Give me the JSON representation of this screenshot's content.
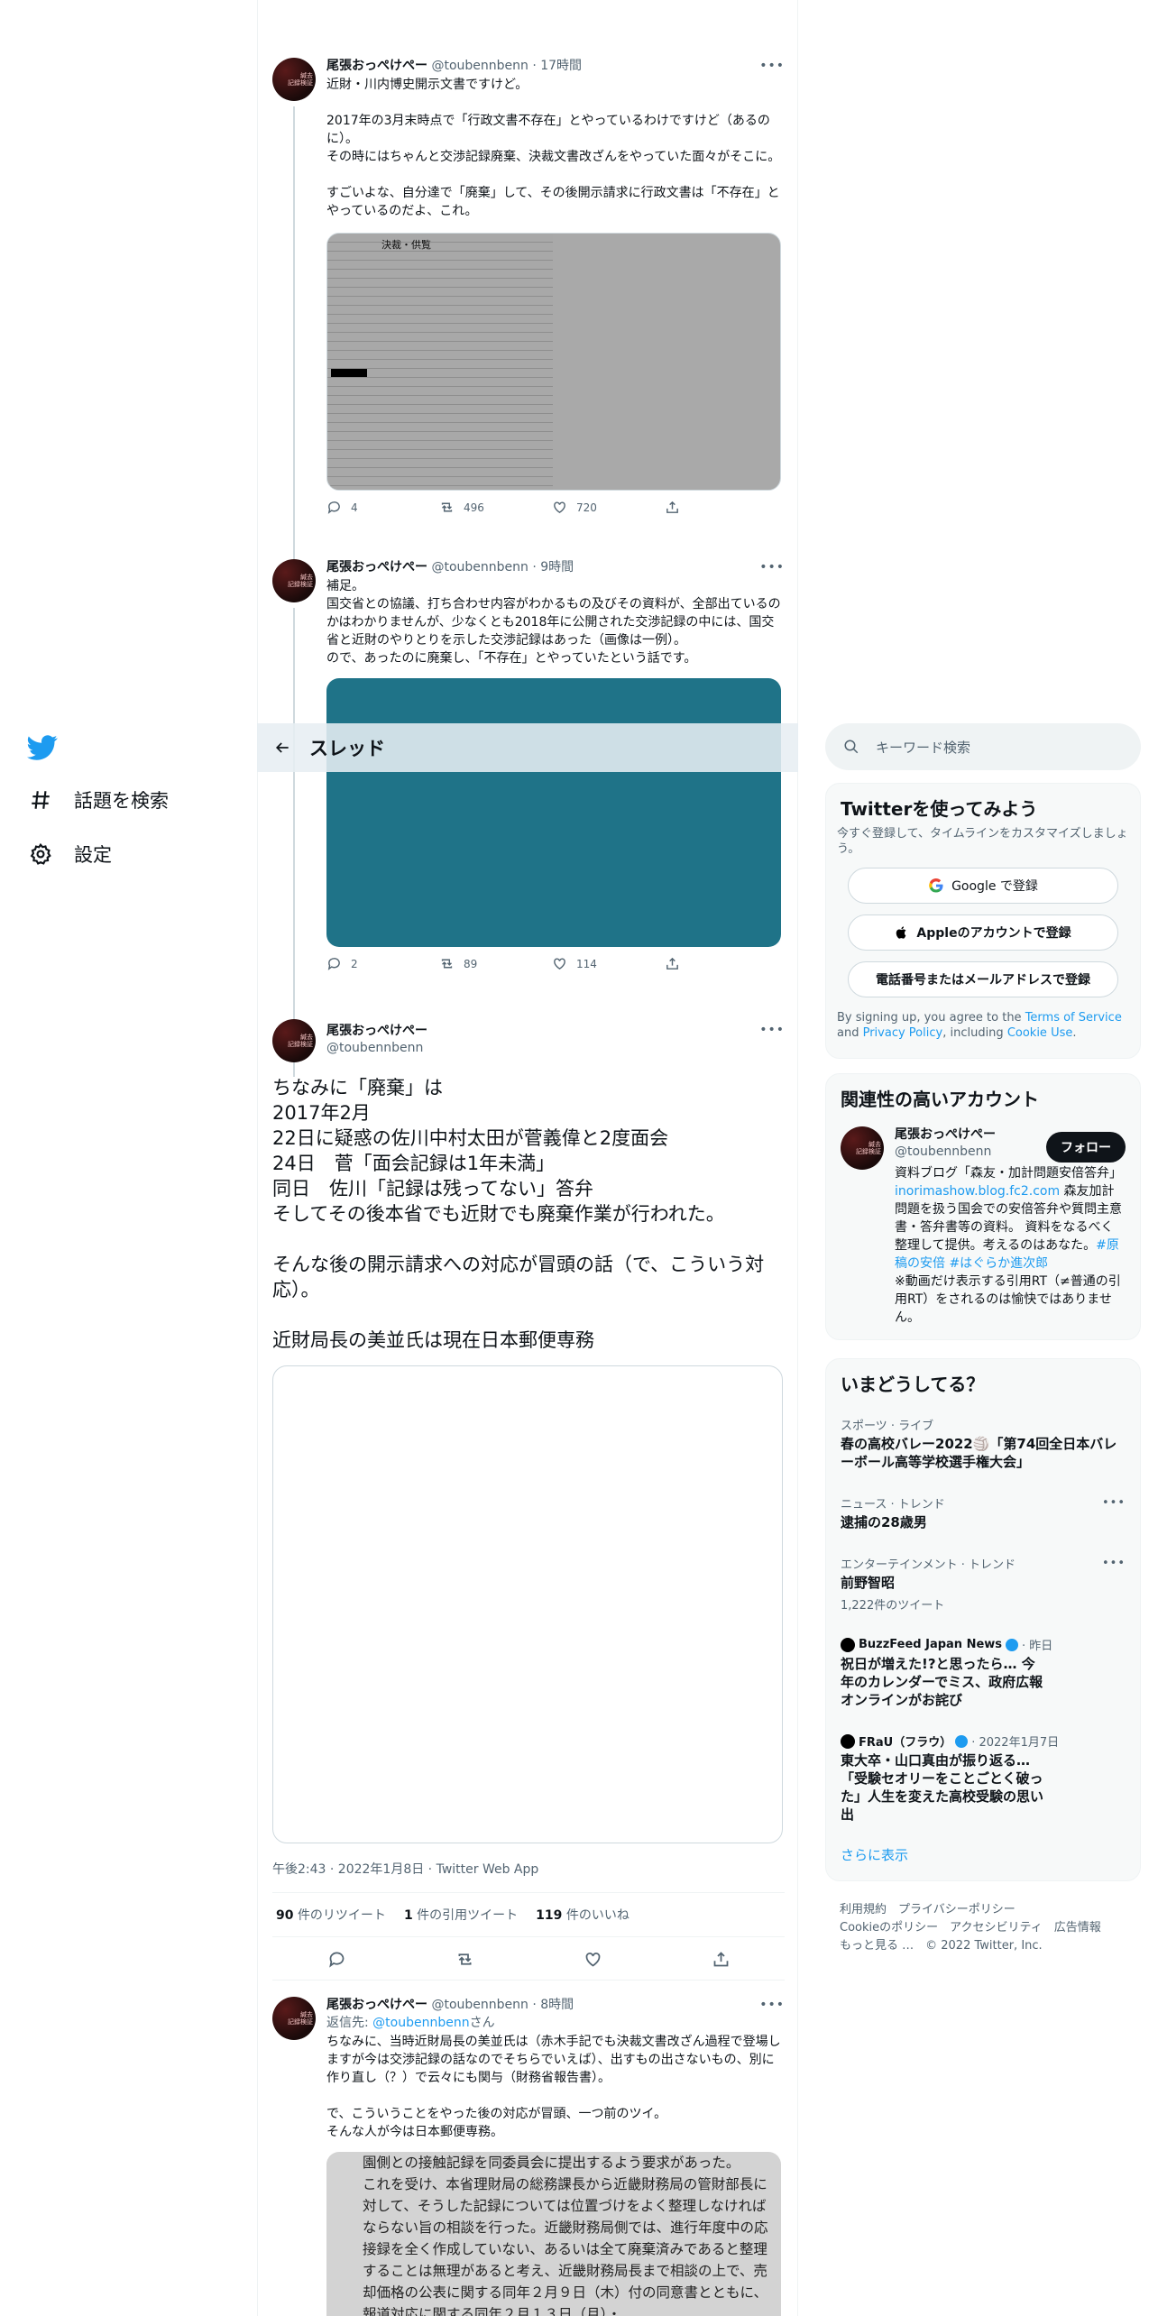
{
  "nav": {
    "explore_label": "話題を検索",
    "settings_label": "設定"
  },
  "header": {
    "title": "スレッド"
  },
  "tweets": [
    {
      "name": "尾張おっぺけぺー",
      "handle": "@toubennbenn",
      "time": "· 17時間",
      "text": "近財・川内博史開示文書ですけど。\n\n2017年の3月末時点で「行政文書不存在」とやっているわけですけど（あるのに）。\nその時にはちゃんと交渉記録廃棄、決裁文書改ざんをやっていた面々がそこに。\n\nすごいよな、自分達で「廃棄」して、その後開示請求に行政文書は「不存在」とやっているのだよ、これ。",
      "image_title": "決裁・供覧",
      "replies": "4",
      "retweets": "496",
      "likes": "720"
    },
    {
      "name": "尾張おっぺけぺー",
      "handle": "@toubennbenn",
      "time": "· 9時間",
      "text": "補足。\n国交省との協議、打ち合わせ内容がわかるもの及びその資料が、全部出ているのかはわかりませんが、少なくとも2018年に公開された交渉記録の中には、国交省と近財のやりとりを示した交渉記録はあった（画像は一例）。\nので、あったのに廃棄し、「不存在」とやっていたという話です。",
      "replies": "2",
      "retweets": "89",
      "likes": "114"
    }
  ],
  "main_tweet": {
    "name": "尾張おっぺけぺー",
    "handle": "@toubennbenn",
    "text": "ちなみに「廃棄」は\n2017年2月\n22日に疑惑の佐川中村太田が菅義偉と2度面会\n24日　菅「面会記録は1年未満」\n同日　佐川「記録は残ってない」答弁\nそしてその後本省でも近財でも廃棄作業が行われた。\n\nそんな後の開示請求への対応が冒頭の話（で、こういう対応）。\n\n近財局長の美並氏は現在日本郵便専務",
    "timestamp": "午後2:43 · 2022年1月8日 · Twitter Web App",
    "retweets_count": "90",
    "retweets_label": "件のリツイート",
    "quotes_count": "1",
    "quotes_label": "件の引用ツイート",
    "likes_count": "119",
    "likes_label": "件のいいね"
  },
  "reply_tweet": {
    "name": "尾張おっぺけぺー",
    "handle": "@toubennbenn",
    "time": "· 8時間",
    "reply_prefix": "返信先:",
    "reply_to": "@toubennbenn",
    "reply_suffix": "さん",
    "text": "ちなみに、当時近財局長の美並氏は（赤木手記でも決裁文書改ざん過程で登場しますが今は交渉記録の話なのでそちらでいえば）、出すもの出さないもの、別に作り直し（？）で云々にも関与（財務省報告書）。\n\nで、こういうことをやった後の対応が冒頭、一つ前のツイ。\nそんな人が今は日本郵便専務。",
    "image_text": "園側との接触記録を同委員会に提出するよう要求があった。\nこれを受け、本省理財局の総務課長から近畿財務局の管財部長に対して、そうした記録については位置づけをよく整理しなければならない旨の相談を行った。近畿財務局側では、進行年度中の応接録を全く作成していない、あるいは全て廃棄済みであると整理することは無理があると考え、近畿財務局長まで相談の上で、売却価格の公表に関する同年２月９日（木）付の同意書とともに、報道対応に関する同年２月１３日（月）・"
  },
  "search": {
    "placeholder": "キーワード検索"
  },
  "signup": {
    "title": "Twitterを使ってみよう",
    "subtitle": "今すぐ登録して、タイムラインをカスタマイズしましょう。",
    "google_label": "Google で登録",
    "apple_label": "Appleのアカウントで登録",
    "phone_label": "電話番号またはメールアドレスで登録",
    "terms_prefix": "By signing up, you agree to the ",
    "terms_link": "Terms of Service",
    "terms_and": " and ",
    "privacy_link": "Privacy Policy",
    "terms_including": ", including ",
    "cookie_link": "Cookie Use",
    "terms_end": "."
  },
  "related": {
    "title": "関連性の高いアカウント",
    "name": "尾張おっぺけぺー",
    "handle": "@toubennbenn",
    "follow_label": "フォロー",
    "bio_1": "資料ブログ「森友・加計問題安倍答弁」",
    "bio_link": "inorimashow.blog.fc2.com",
    "bio_2": " 森友加計問題を扱う国会での安倍答弁や質問主意書・答弁書等の資料。 資料をなるべく整理して提供。考えるのはあなた。",
    "bio_tags": "#原稿の安倍 #はぐらか進次郎",
    "bio_3": "※動画だけ表示する引用RT（≠普通の引用RT）をされるのは愉快ではありません。"
  },
  "trends": {
    "title": "いまどうしてる？",
    "items": [
      {
        "category": "スポーツ · ライブ",
        "title": "春の高校バレー2022🏐「第74回全日本バレーボール高等学校選手権大会」",
        "count": ""
      },
      {
        "category": "ニュース · トレンド",
        "title": "逮捕の28歳男",
        "count": ""
      },
      {
        "category": "エンターテインメント · トレンド",
        "title": "前野智昭",
        "count": "1,222件のツイート"
      },
      {
        "category": "BuzzFeed Japan News",
        "category_suffix": "· 昨日",
        "title": "祝日が増えた!?と思ったら… 今年のカレンダーでミス、政府広報オンラインがお詫び",
        "count": ""
      },
      {
        "category": "FRaU（フラウ）",
        "category_suffix": "· 2022年1月7日",
        "title": "東大卒・山口真由が振り返る…「受験セオリーをことごとく破った」人生を変えた高校受験の思い出",
        "count": ""
      }
    ],
    "show_more": "さらに表示"
  },
  "footer": {
    "line1": "利用規約　プライバシーポリシー",
    "line2": "Cookieのポリシー　アクセシビリティ　広告情報",
    "line3": "もっと見る …　© 2022 Twitter, Inc."
  },
  "colors": {
    "accent": "#1d9bf0",
    "teal_image": "#1f7388",
    "text": "#0f1419",
    "muted": "#536471"
  }
}
